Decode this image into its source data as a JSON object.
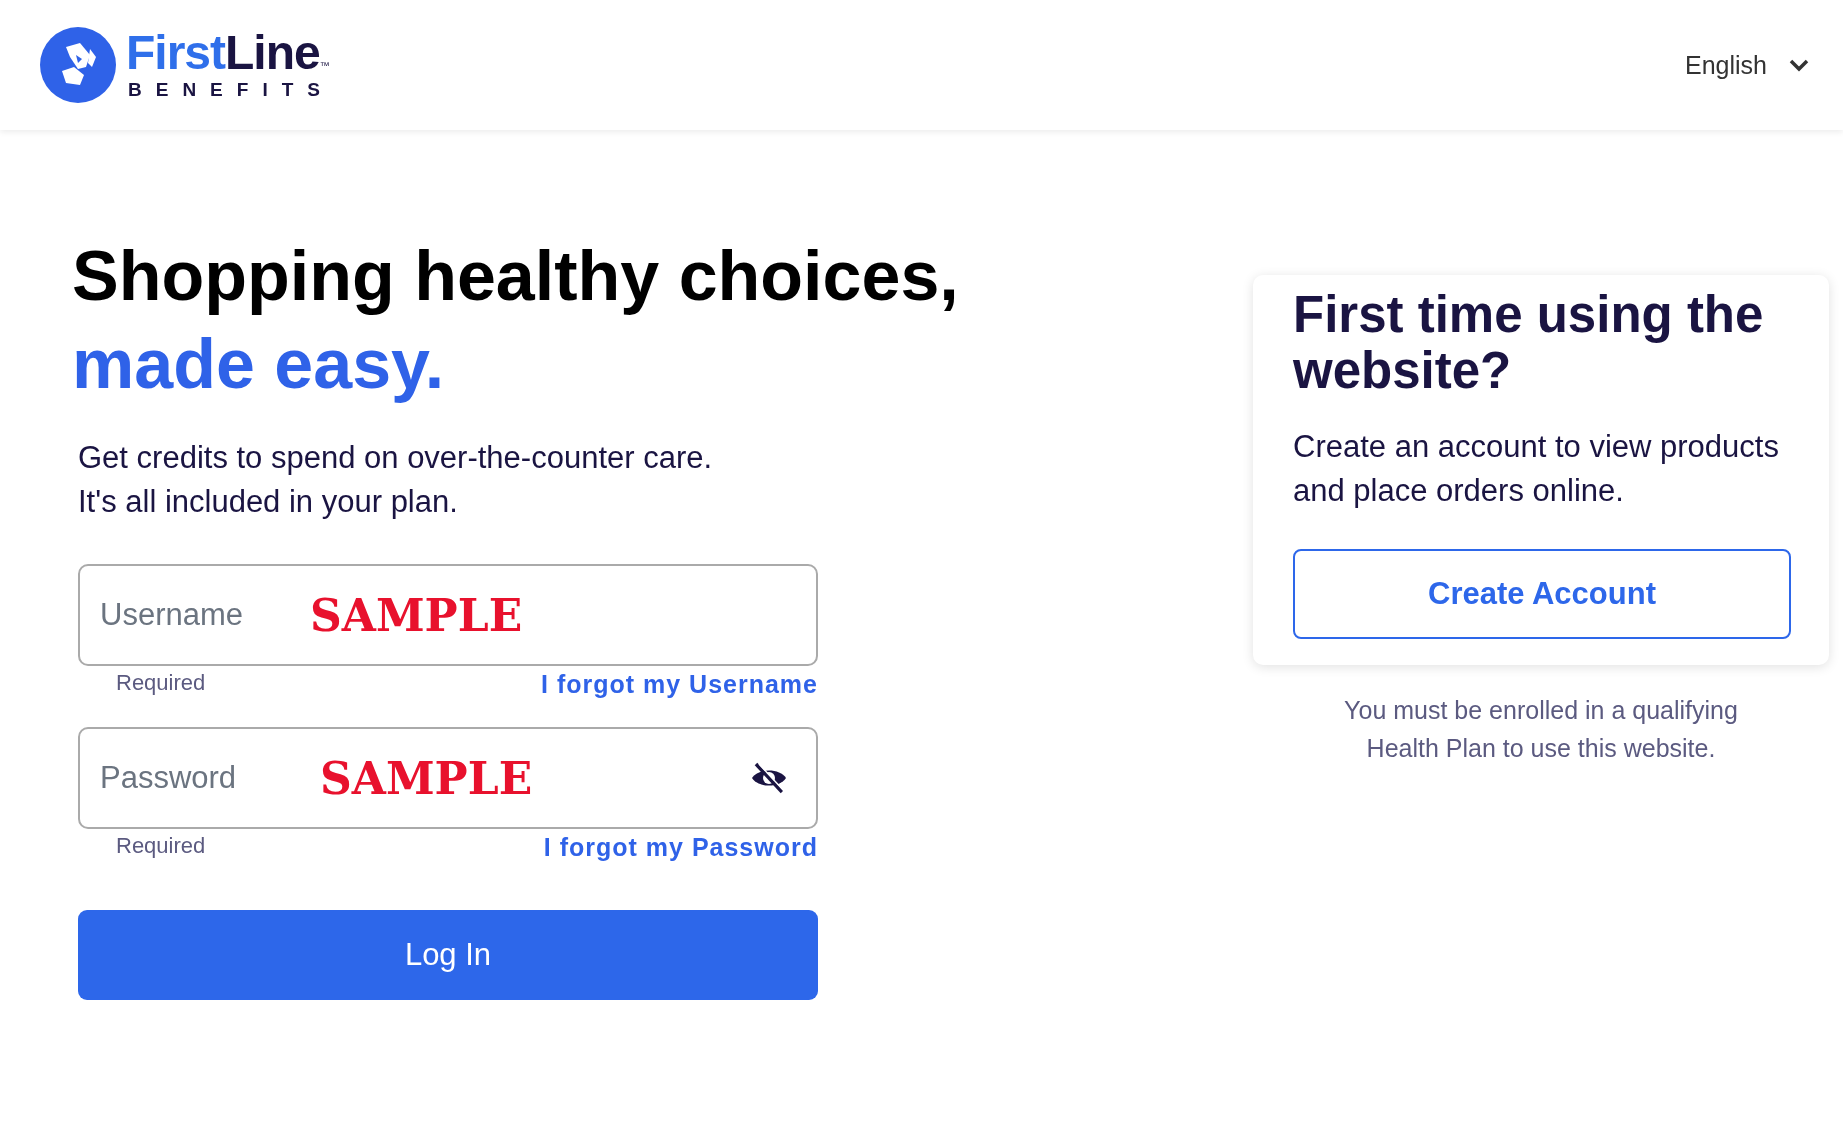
{
  "header": {
    "logo": {
      "first": "First",
      "second": "Line",
      "trademark": "™",
      "tagline": "BENEFITS"
    },
    "language": {
      "label": "English",
      "expanded": false
    }
  },
  "hero": {
    "title": "Shopping healthy choices,",
    "title_accent": "made easy.",
    "lines": [
      "Get credits to spend on over-the-counter care.",
      "It's all included in your plan."
    ]
  },
  "form": {
    "fields": [
      {
        "kind": "text",
        "label": "Username",
        "value": "SAMPLE",
        "hint": "Required",
        "link": "I forgot my Username"
      },
      {
        "kind": "password",
        "label": "Password",
        "value": "SAMPLE",
        "hint": "Required",
        "link": "I forgot my Password",
        "revealed": true
      }
    ],
    "submit": "Log In"
  },
  "signup": {
    "title": "First time using the website?",
    "text": "Create an account to view products and place orders online.",
    "button": "Create Account",
    "note": "You must be enrolled in a qualifying Health Plan to use this website."
  }
}
